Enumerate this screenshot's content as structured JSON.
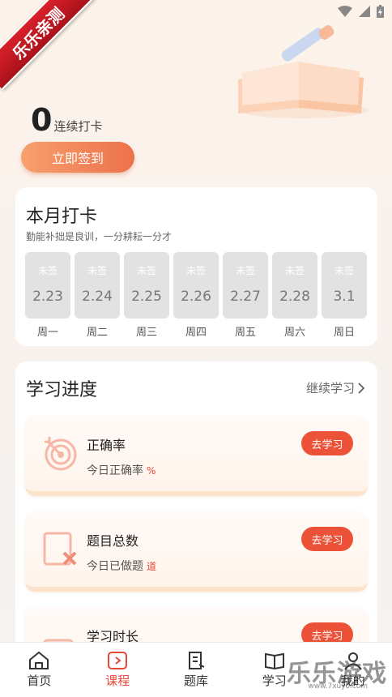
{
  "ribbon": {
    "text": "乐乐亲测"
  },
  "streak": {
    "count": "0",
    "label": "连续打卡"
  },
  "checkin": {
    "label": "立即签到"
  },
  "month": {
    "title": "本月打卡",
    "subtitle": "勤能补拙是良训，一分耕耘一分才",
    "days": [
      {
        "status": "未签",
        "date": "2.23",
        "weekday": "周一"
      },
      {
        "status": "未签",
        "date": "2.24",
        "weekday": "周二"
      },
      {
        "status": "未签",
        "date": "2.25",
        "weekday": "周三"
      },
      {
        "status": "未签",
        "date": "2.26",
        "weekday": "周四"
      },
      {
        "status": "未签",
        "date": "2.27",
        "weekday": "周五"
      },
      {
        "status": "未签",
        "date": "2.28",
        "weekday": "周六"
      },
      {
        "status": "未签",
        "date": "3.1",
        "weekday": "周日"
      }
    ]
  },
  "progress": {
    "title": "学习进度",
    "link": "继续学习",
    "items": [
      {
        "title": "正确率",
        "sub": "今日正确率",
        "unit": "%",
        "button": "去学习",
        "icon": "target-icon"
      },
      {
        "title": "题目总数",
        "sub": "今日已做题",
        "unit": "道",
        "button": "去学习",
        "icon": "wrong-book-icon"
      },
      {
        "title": "学习时长",
        "button": "去学习",
        "icon": "document-icon"
      }
    ]
  },
  "tabs": [
    {
      "label": "首页",
      "icon": "home-icon"
    },
    {
      "label": "课程",
      "icon": "play-icon"
    },
    {
      "label": "题库",
      "icon": "notebook-icon"
    },
    {
      "label": "学习",
      "icon": "book-icon"
    },
    {
      "label": "我的",
      "icon": "user-icon"
    }
  ],
  "watermark": {
    "text": "乐乐游戏",
    "sub": "www.7xuyo.com"
  },
  "colors": {
    "accent": "#ec5238",
    "checkin_gradient_start": "#f7a06e",
    "checkin_gradient_end": "#ec7149"
  }
}
